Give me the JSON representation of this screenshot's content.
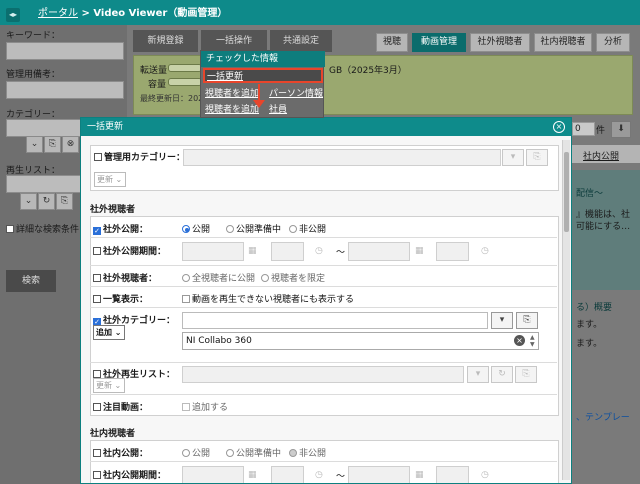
{
  "header": {
    "breadcrumb_portal": "ポータル",
    "breadcrumb_sep": ">",
    "breadcrumb_current": "Video Viewer（動画管理）"
  },
  "sidebar": {
    "keyword_label": "キーワード：",
    "admin_note_label": "管理用備考：",
    "category_label": "カテゴリー：",
    "playlist_label": "再生リスト：",
    "detail_label": "詳細な検索条件",
    "search_button": "検索"
  },
  "toolbar": {
    "new_button": "新規登録",
    "bulk_button": "一括操作",
    "common_button": "共通設定",
    "tabs": [
      "視聴",
      "動画管理",
      "社外視聴者",
      "社内視聴者",
      "分析"
    ]
  },
  "info_panel": {
    "transfer_label": "転送量",
    "capacity_label": "容量",
    "transfer_tail": "GB（2025年3月）",
    "updated_label": "最終更新日：202"
  },
  "dropdown": {
    "header": "チェックした情報",
    "item_bulk_update": "一括更新",
    "item_add_viewer": "視聴者を追加",
    "item_persona": "パーソン情報",
    "item_add_viewer2": "視聴者を追加",
    "item_staff": "社員"
  },
  "background": {
    "count_value": "0",
    "count_unit": "件",
    "internal_public_link": "社内公開",
    "snippet_1": "配信〜",
    "snippet_2": "』機能は、社",
    "snippet_3": "可能にする…",
    "snippet_4": "る）概要",
    "snippet_5": "ます。",
    "snippet_6": "ます。",
    "template_link": "、テンプレー"
  },
  "modal": {
    "title": "一括更新",
    "admin_category_label": "管理用カテゴリー：",
    "admin_category_mode": "更新",
    "external_section": "社外視聴者",
    "ext_public_label": "社外公開：",
    "ext_public_options": [
      "公開",
      "公開準備中",
      "非公開"
    ],
    "ext_period_label": "社外公開期間：",
    "tilde": "〜",
    "ext_viewer_label": "社外視聴者：",
    "ext_viewer_options": [
      "全視聴者に公開",
      "視聴者を限定"
    ],
    "list_display_label": "一覧表示：",
    "list_display_option": "動画を再生できない視聴者にも表示する",
    "ext_category_label": "社外カテゴリー：",
    "ext_category_mode": "追加",
    "ext_category_value": "NI Collabo 360",
    "ext_playlist_label": "社外再生リスト：",
    "ext_playlist_mode": "更新",
    "featured_label": "注目動画：",
    "featured_option": "追加する",
    "internal_section": "社内視聴者",
    "int_public_label": "社内公開：",
    "int_public_options": [
      "公開",
      "公開準備中",
      "非公開"
    ],
    "int_period_label": "社内公開期間："
  }
}
